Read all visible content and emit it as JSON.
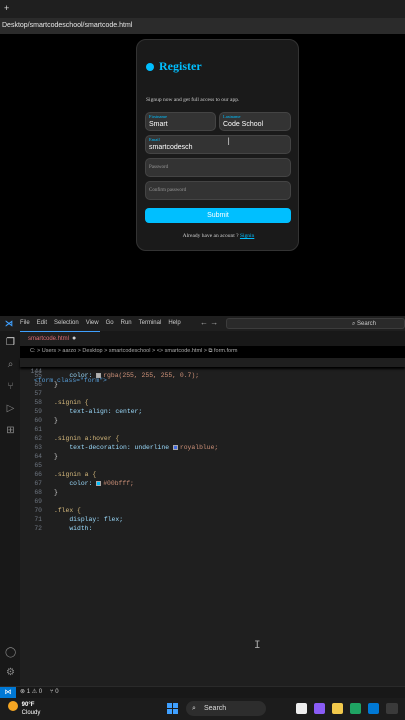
{
  "browser": {
    "new_tab_glyph": "+",
    "url": "Desktop/smartcodeschool/smartcode.html"
  },
  "form": {
    "title": "Register",
    "subtitle": "Signup now and get full access to our app.",
    "firstname_label": "Firstname",
    "firstname_value": "Smart",
    "lastname_label": "Lastname",
    "lastname_value": "Code School",
    "email_label": "Email",
    "email_value": "smartcodesch",
    "password_placeholder": "Password",
    "confirm_placeholder": "Confirm password",
    "submit_label": "Submit",
    "signin_text": "Already have an acount ?",
    "signin_link": "Signin",
    "accent": "#00bfff"
  },
  "vscode": {
    "menu": [
      "File",
      "Edit",
      "Selection",
      "View",
      "Go",
      "Run",
      "Terminal",
      "Help"
    ],
    "search_label": "Search",
    "tab_name": "smartcode.html",
    "tab_modified_dot": "●",
    "breadcrumb": "C: > Users > aarzo > Desktop > smartcodeschool > <> smartcode.html > ⧉ form.form",
    "sticky_line_number": "144",
    "status_errors": "⊗ 1 ⚠ 0",
    "status_ports": "⑂ 0"
  },
  "code_lines": [
    {
      "n": "55",
      "t": "    color: ",
      "swatch": "#b3b3b3",
      "rest": "rgba(255, 255, 255, 0.7);"
    },
    {
      "n": "56",
      "t": "}"
    },
    {
      "n": "57",
      "t": ""
    },
    {
      "n": "58",
      "t": ".signin {"
    },
    {
      "n": "59",
      "t": "    text-align: center;"
    },
    {
      "n": "60",
      "t": "}"
    },
    {
      "n": "61",
      "t": ""
    },
    {
      "n": "62",
      "t": ".signin a:hover {"
    },
    {
      "n": "63",
      "t": "    text-decoration: underline ",
      "swatch": "#4169e1",
      "rest": "royalblue;"
    },
    {
      "n": "64",
      "t": "}"
    },
    {
      "n": "65",
      "t": ""
    },
    {
      "n": "66",
      "t": ".signin a {"
    },
    {
      "n": "67",
      "t": "    color: ",
      "swatch": "#00bfff",
      "rest": "#00bfff;"
    },
    {
      "n": "68",
      "t": "}"
    },
    {
      "n": "69",
      "t": ""
    },
    {
      "n": "70",
      "t": ".flex {"
    },
    {
      "n": "71",
      "t": "    display: flex;"
    },
    {
      "n": "72",
      "t": "    width:"
    }
  ],
  "sticky_code": "<form class=\"form\">",
  "taskbar": {
    "temperature": "90°F",
    "condition": "Cloudy",
    "weather_badge": "1",
    "search_label": "Search"
  }
}
